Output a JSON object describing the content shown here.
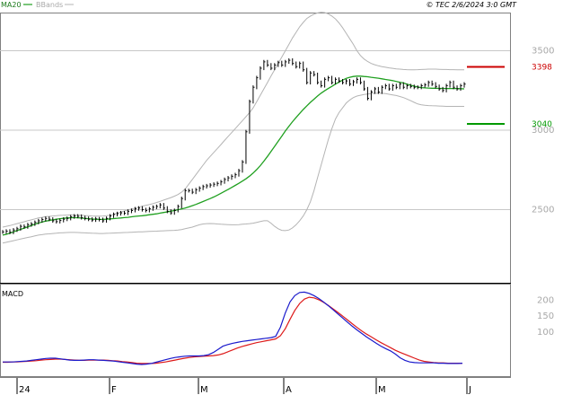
{
  "header": {
    "legend_ma": "MA20",
    "legend_bb": "BBands",
    "copyright": "© TEC 2/6/2024 3:0 GMT"
  },
  "colors": {
    "ma": "#20a020",
    "bands": "#b4b4b4",
    "candle": "#000000",
    "resistance": "#cc0000",
    "support": "#009900",
    "macd": "#1a1acc",
    "signal": "#dd1a1a",
    "grid": "#c8c8c8"
  },
  "chart_data": [
    {
      "type": "line",
      "title": "",
      "y_ticks": [
        "3500",
        "3000",
        "2500"
      ],
      "ylim": [
        2040,
        3740
      ],
      "x_ticks": [
        "24",
        "F",
        "M",
        "A",
        "M",
        "J"
      ],
      "levels": [
        {
          "label": "3398",
          "value": 3398,
          "role": "resistance"
        },
        {
          "label": "3040",
          "value": 3040,
          "role": "support"
        }
      ],
      "series": [
        {
          "name": "MA20",
          "role": "ma",
          "values": [
            2340,
            2345,
            2352,
            2360,
            2368,
            2376,
            2384,
            2392,
            2400,
            2408,
            2416,
            2422,
            2428,
            2432,
            2436,
            2440,
            2443,
            2446,
            2448,
            2449,
            2450,
            2449,
            2447,
            2445,
            2443,
            2441,
            2440,
            2439,
            2439,
            2440,
            2442,
            2444,
            2446,
            2448,
            2450,
            2452,
            2455,
            2458,
            2460,
            2462,
            2465,
            2468,
            2471,
            2474,
            2478,
            2482,
            2486,
            2490,
            2495,
            2500,
            2505,
            2510,
            2517,
            2525,
            2533,
            2542,
            2551,
            2561,
            2570,
            2580,
            2591,
            2603,
            2615,
            2627,
            2640,
            2653,
            2666,
            2680,
            2694,
            2711,
            2730,
            2752,
            2777,
            2805,
            2835,
            2866,
            2898,
            2930,
            2962,
            2995,
            3025,
            3053,
            3080,
            3105,
            3130,
            3153,
            3175,
            3195,
            3215,
            3233,
            3248,
            3262,
            3276,
            3290,
            3303,
            3315,
            3326,
            3333,
            3338,
            3340,
            3340,
            3338,
            3336,
            3333,
            3330,
            3327,
            3323,
            3319,
            3316,
            3312,
            3307,
            3302,
            3297,
            3290,
            3283,
            3277,
            3272,
            3268,
            3266,
            3265,
            3264,
            3264,
            3263,
            3263,
            3262,
            3262,
            3262,
            3262,
            3261,
            3260
          ]
        },
        {
          "name": "BBands",
          "role": "upper",
          "values": [
            2390,
            2395,
            2400,
            2406,
            2412,
            2418,
            2424,
            2430,
            2436,
            2442,
            2448,
            2452,
            2456,
            2458,
            2460,
            2462,
            2464,
            2465,
            2466,
            2467,
            2467,
            2466,
            2465,
            2463,
            2462,
            2460,
            2459,
            2459,
            2460,
            2462,
            2465,
            2470,
            2478,
            2485,
            2492,
            2498,
            2504,
            2510,
            2516,
            2522,
            2527,
            2532,
            2538,
            2545,
            2552,
            2560,
            2568,
            2576,
            2585,
            2595,
            2610,
            2630,
            2660,
            2690,
            2720,
            2750,
            2780,
            2810,
            2835,
            2860,
            2885,
            2910,
            2935,
            2960,
            2985,
            3010,
            3035,
            3060,
            3085,
            3110,
            3140,
            3180,
            3220,
            3260,
            3300,
            3340,
            3380,
            3420,
            3460,
            3500,
            3540,
            3580,
            3615,
            3650,
            3678,
            3703,
            3718,
            3730,
            3738,
            3742,
            3740,
            3732,
            3718,
            3700,
            3675,
            3645,
            3610,
            3575,
            3540,
            3500,
            3470,
            3448,
            3432,
            3420,
            3412,
            3405,
            3400,
            3396,
            3392,
            3389,
            3386,
            3384,
            3382,
            3381,
            3380,
            3380,
            3381,
            3382,
            3383,
            3384,
            3384,
            3384,
            3383,
            3382,
            3382,
            3381,
            3381,
            3380,
            3380,
            3380
          ]
        },
        {
          "name": "BBands",
          "role": "lower",
          "values": [
            2290,
            2295,
            2300,
            2305,
            2310,
            2315,
            2320,
            2325,
            2330,
            2335,
            2340,
            2343,
            2346,
            2348,
            2350,
            2352,
            2354,
            2355,
            2356,
            2357,
            2357,
            2356,
            2355,
            2354,
            2353,
            2352,
            2351,
            2350,
            2350,
            2351,
            2352,
            2353,
            2354,
            2355,
            2356,
            2357,
            2358,
            2359,
            2360,
            2361,
            2362,
            2363,
            2364,
            2365,
            2366,
            2367,
            2368,
            2369,
            2370,
            2372,
            2375,
            2380,
            2385,
            2390,
            2398,
            2405,
            2410,
            2412,
            2413,
            2412,
            2410,
            2408,
            2407,
            2406,
            2405,
            2405,
            2406,
            2408,
            2410,
            2412,
            2415,
            2420,
            2425,
            2430,
            2430,
            2415,
            2395,
            2380,
            2370,
            2368,
            2372,
            2385,
            2405,
            2430,
            2460,
            2500,
            2550,
            2620,
            2700,
            2780,
            2860,
            2940,
            3010,
            3070,
            3110,
            3140,
            3170,
            3190,
            3205,
            3215,
            3220,
            3225,
            3228,
            3230,
            3232,
            3233,
            3232,
            3230,
            3226,
            3222,
            3218,
            3212,
            3205,
            3196,
            3186,
            3175,
            3165,
            3160,
            3157,
            3155,
            3154,
            3153,
            3152,
            3151,
            3150,
            3150,
            3150,
            3150,
            3150,
            3150
          ]
        },
        {
          "name": "Price",
          "role": "price",
          "values": [
            2360,
            2365,
            2358,
            2372,
            2380,
            2395,
            2392,
            2405,
            2410,
            2420,
            2430,
            2438,
            2445,
            2440,
            2430,
            2425,
            2432,
            2440,
            2445,
            2455,
            2460,
            2458,
            2450,
            2445,
            2440,
            2435,
            2442,
            2438,
            2430,
            2445,
            2460,
            2470,
            2475,
            2480,
            2478,
            2490,
            2495,
            2505,
            2510,
            2500,
            2495,
            2505,
            2515,
            2520,
            2530,
            2510,
            2490,
            2480,
            2495,
            2520,
            2570,
            2620,
            2620,
            2610,
            2625,
            2635,
            2645,
            2650,
            2655,
            2660,
            2665,
            2675,
            2690,
            2700,
            2710,
            2720,
            2745,
            2800,
            2990,
            3180,
            3270,
            3330,
            3390,
            3430,
            3410,
            3390,
            3410,
            3425,
            3410,
            3430,
            3440,
            3420,
            3400,
            3420,
            3380,
            3300,
            3360,
            3350,
            3300,
            3280,
            3320,
            3330,
            3300,
            3320,
            3310,
            3300,
            3310,
            3290,
            3305,
            3320,
            3300,
            3260,
            3200,
            3240,
            3260,
            3240,
            3270,
            3280,
            3260,
            3280,
            3270,
            3290,
            3270,
            3280,
            3275,
            3270,
            3270,
            3280,
            3285,
            3300,
            3290,
            3275,
            3260,
            3250,
            3280,
            3300,
            3270,
            3260,
            3280,
            3290
          ]
        }
      ]
    },
    {
      "type": "line",
      "title": "MACD",
      "y_ticks": [
        "200",
        "150",
        "100"
      ],
      "ylim": [
        -40,
        250
      ],
      "series": [
        {
          "name": "MACD",
          "role": "macd",
          "values": [
            5,
            5,
            5,
            6,
            7,
            8,
            10,
            12,
            14,
            16,
            17,
            17,
            15,
            13,
            11,
            10,
            10,
            11,
            12,
            12,
            11,
            10,
            9,
            8,
            6,
            4,
            2,
            0,
            -2,
            -3,
            -2,
            0,
            4,
            8,
            12,
            16,
            19,
            21,
            23,
            24,
            24,
            24,
            25,
            28,
            35,
            45,
            55,
            60,
            64,
            67,
            70,
            72,
            74,
            76,
            78,
            80,
            82,
            86,
            115,
            160,
            195,
            215,
            225,
            226,
            222,
            215,
            206,
            195,
            183,
            170,
            157,
            144,
            131,
            118,
            106,
            95,
            84,
            74,
            64,
            55,
            47,
            40,
            30,
            18,
            10,
            5,
            3,
            2,
            2,
            2,
            2,
            1,
            1,
            0,
            0,
            0,
            1
          ]
        },
        {
          "name": "Signal",
          "role": "signal",
          "values": [
            4,
            4,
            5,
            5,
            6,
            7,
            8,
            9,
            11,
            12,
            13,
            14,
            14,
            13,
            12,
            11,
            10,
            10,
            11,
            11,
            11,
            11,
            10,
            9,
            8,
            6,
            5,
            3,
            1,
            0,
            0,
            0,
            1,
            3,
            5,
            8,
            11,
            14,
            17,
            19,
            21,
            22,
            23,
            24,
            25,
            27,
            31,
            37,
            43,
            49,
            54,
            58,
            62,
            66,
            69,
            72,
            75,
            78,
            88,
            110,
            140,
            168,
            190,
            204,
            210,
            208,
            202,
            194,
            184,
            173,
            162,
            150,
            138,
            126,
            114,
            103,
            93,
            84,
            75,
            66,
            58,
            50,
            42,
            35,
            29,
            23,
            17,
            11,
            7,
            5,
            3,
            2,
            2,
            1,
            1,
            1,
            1
          ]
        }
      ]
    }
  ]
}
